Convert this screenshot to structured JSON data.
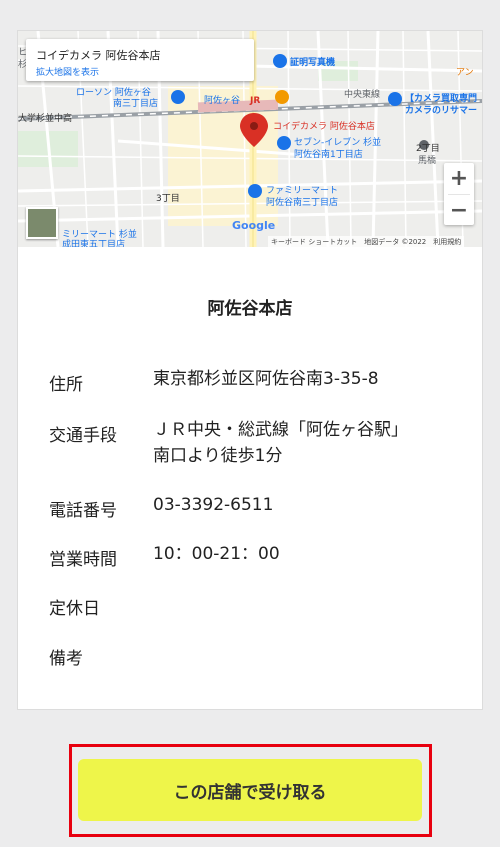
{
  "map": {
    "popup_name": "コイデカメラ 阿佐谷本店",
    "popup_link": "拡大地図を表示",
    "zoom_in": "+",
    "zoom_out": "−",
    "google_label": "Google",
    "attribution": "キーボード ショートカット　地図データ ©2022　利用規約",
    "labels": {
      "studio": "証明写真機",
      "lawson": "ローソン 阿佐ヶ谷",
      "lawson2": "南三丁目店",
      "station": "阿佐ヶ谷",
      "jr": "JR",
      "chuo": "中央東線",
      "camera_buy": "【カメラ買取専門",
      "camera_buy2": "カメラのリサマー",
      "university": "大学杉並中高",
      "store_pin": "コイデカメラ 阿佐谷本店",
      "seven1": "セブン-イレブン 杉並",
      "seven2": "阿佐谷南1丁目店",
      "chome2": "2丁目",
      "umabashi": "馬橋",
      "chome3": "3丁目",
      "family1": "ファミリーマート",
      "family2": "阿佐谷南三丁目店",
      "fm_bottom1": "ミリーマート 杉並",
      "fm_bottom2": "成田東五丁目店",
      "an": "アン",
      "left_edge": "ヒ",
      "left_edge2": "杉"
    }
  },
  "store": {
    "title": "阿佐谷本店",
    "rows": [
      {
        "label": "住所",
        "value": "東京都杉並区阿佐谷南3-35-8"
      },
      {
        "label": "交通手段",
        "value": "ＪＲ中央・総武線「阿佐ヶ谷駅」",
        "value2": "南口より徒歩1分"
      },
      {
        "label": "電話番号",
        "value": "03-3392-6511"
      },
      {
        "label": "営業時間",
        "value": "10：00-21：00"
      },
      {
        "label": "定休日",
        "value": ""
      },
      {
        "label": "備考",
        "value": ""
      }
    ]
  },
  "action": {
    "receive_label": "この店舗で受け取る"
  },
  "colors": {
    "button_bg": "#eef54a",
    "highlight_frame": "#e8000f",
    "map_pin": "#d93025",
    "rail": "#9aa0a6"
  }
}
